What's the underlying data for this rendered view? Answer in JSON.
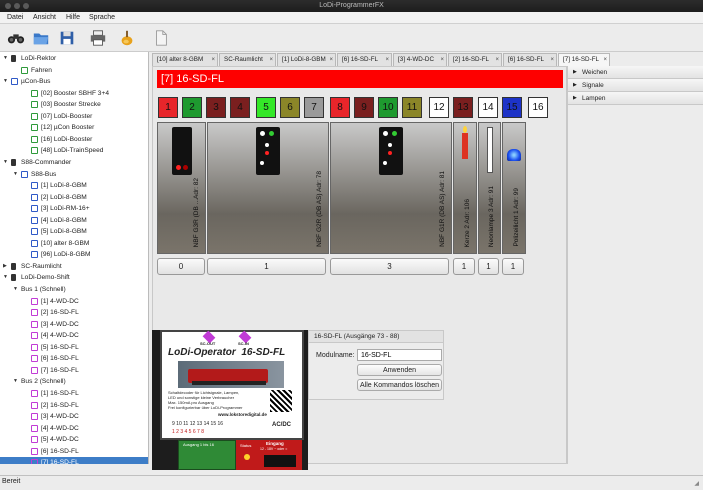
{
  "window": {
    "title": "LoDi-ProgrammerFX"
  },
  "menu": [
    "Datei",
    "Ansicht",
    "Hilfe",
    "Sprache"
  ],
  "toolbar": {
    "icons": [
      "binoculars-icon",
      "open-folder-icon",
      "save-icon",
      "print-icon",
      "clean-icon",
      "new-document-icon"
    ]
  },
  "tree": [
    {
      "label": "LoDi-Rektor",
      "depth": 0,
      "icon": "device",
      "expanded": true
    },
    {
      "label": "Fahren",
      "depth": 1,
      "icon": "green"
    },
    {
      "label": "µCon-Bus",
      "depth": 0,
      "icon": "bus",
      "expanded": true
    },
    {
      "label": "[02] Booster SBHF 3+4",
      "depth": 2,
      "icon": "green"
    },
    {
      "label": "[03] Booster Strecke",
      "depth": 2,
      "icon": "green"
    },
    {
      "label": "[07] LoDi-Booster",
      "depth": 2,
      "icon": "green"
    },
    {
      "label": "[12] µCon Booster",
      "depth": 2,
      "icon": "green"
    },
    {
      "label": "[16] LoDi-Booster",
      "depth": 2,
      "icon": "green"
    },
    {
      "label": "[48] LoDi-TrainSpeed",
      "depth": 2,
      "icon": "green"
    },
    {
      "label": "S88-Commander",
      "depth": 0,
      "icon": "device",
      "expanded": true
    },
    {
      "label": "S88-Bus",
      "depth": 1,
      "icon": "bus",
      "expanded": true
    },
    {
      "label": "[1] LoDi-8-GBM",
      "depth": 2,
      "icon": "blue"
    },
    {
      "label": "[2] LoDi-8-GBM",
      "depth": 2,
      "icon": "blue"
    },
    {
      "label": "[3] LoDi-RM-16+",
      "depth": 2,
      "icon": "blue"
    },
    {
      "label": "[4] LoDi-8-GBM",
      "depth": 2,
      "icon": "blue"
    },
    {
      "label": "[5] LoDi-8-GBM",
      "depth": 2,
      "icon": "blue"
    },
    {
      "label": "[10] alter 8-GBM",
      "depth": 2,
      "icon": "blue"
    },
    {
      "label": "[96] LoDi-8-GBM",
      "depth": 2,
      "icon": "blue"
    },
    {
      "label": "SC-Raumlicht",
      "depth": 0,
      "icon": "device",
      "expanded": false
    },
    {
      "label": "LoDi-Demo-Shift",
      "depth": 0,
      "icon": "device",
      "expanded": true
    },
    {
      "label": "Bus 1 (Schnell)",
      "depth": 1,
      "icon": "none",
      "expanded": true
    },
    {
      "label": "[1] 4-WD-DC",
      "depth": 2,
      "icon": "pink"
    },
    {
      "label": "[2] 16-SD-FL",
      "depth": 2,
      "icon": "pink"
    },
    {
      "label": "[3] 4-WD-DC",
      "depth": 2,
      "icon": "pink"
    },
    {
      "label": "[4] 4-WD-DC",
      "depth": 2,
      "icon": "pink"
    },
    {
      "label": "[5] 16-SD-FL",
      "depth": 2,
      "icon": "pink"
    },
    {
      "label": "[6] 16-SD-FL",
      "depth": 2,
      "icon": "pink"
    },
    {
      "label": "[7] 16-SD-FL",
      "depth": 2,
      "icon": "pink"
    },
    {
      "label": "Bus 2 (Schnell)",
      "depth": 1,
      "icon": "none",
      "expanded": true
    },
    {
      "label": "[1] 16-SD-FL",
      "depth": 2,
      "icon": "pink"
    },
    {
      "label": "[2] 16-SD-FL",
      "depth": 2,
      "icon": "pink"
    },
    {
      "label": "[3] 4-WD-DC",
      "depth": 2,
      "icon": "pink"
    },
    {
      "label": "[4] 4-WD-DC",
      "depth": 2,
      "icon": "pink"
    },
    {
      "label": "[5] 4-WD-DC",
      "depth": 2,
      "icon": "pink"
    },
    {
      "label": "[6] 16-SD-FL",
      "depth": 2,
      "icon": "pink"
    },
    {
      "label": "[7] 16-SD-FL",
      "depth": 2,
      "icon": "pink",
      "selected": true
    }
  ],
  "tabs": [
    {
      "label": "[10] alter 8-GBM",
      "closable": true
    },
    {
      "label": "SC-Raumlicht",
      "closable": true
    },
    {
      "label": "[1] LoDi-8-GBM",
      "closable": true
    },
    {
      "label": "[6] 16-SD-FL",
      "closable": true
    },
    {
      "label": "[3] 4-WD-DC",
      "closable": true
    },
    {
      "label": "[2] 16-SD-FL",
      "closable": true
    },
    {
      "label": "[6] 16-SD-FL",
      "closable": true
    },
    {
      "label": "[7] 16-SD-FL",
      "closable": true,
      "active": true
    }
  ],
  "module": {
    "title": "[7] 16-SD-FL",
    "outputs": [
      {
        "n": "1",
        "color": "#e8252a",
        "text": "#111"
      },
      {
        "n": "2",
        "color": "#1e9a2f",
        "text": "#111"
      },
      {
        "n": "3",
        "color": "#7a1f1f",
        "text": "#111"
      },
      {
        "n": "4",
        "color": "#7a1f1f",
        "text": "#111"
      },
      {
        "n": "5",
        "color": "#34e828",
        "text": "#111"
      },
      {
        "n": "6",
        "color": "#8b8628",
        "text": "#111"
      },
      {
        "n": "7",
        "color": "#9a9a9a",
        "text": "#111"
      },
      {
        "n": "8",
        "color": "#e8252a",
        "text": "#111"
      },
      {
        "n": "9",
        "color": "#7a1f1f",
        "text": "#111"
      },
      {
        "n": "10",
        "color": "#1e9a2f",
        "text": "#111"
      },
      {
        "n": "11",
        "color": "#8b8628",
        "text": "#111"
      },
      {
        "n": "12",
        "color": "#ffffff",
        "text": "#111"
      },
      {
        "n": "13",
        "color": "#7a1f1f",
        "text": "#111"
      },
      {
        "n": "14",
        "color": "#ffffff",
        "text": "#111"
      },
      {
        "n": "15",
        "color": "#1d33c8",
        "text": "#111"
      },
      {
        "n": "16",
        "color": "#ffffff",
        "text": "#111"
      }
    ],
    "signals": [
      {
        "label": "NBF G3R (DB ...Adr: 82",
        "button": "0",
        "type": "mast2"
      },
      {
        "label": "NBF G2R (DB AS) Adr: 78",
        "button": "1",
        "type": "mast5"
      },
      {
        "label": "NBF G1R (DB AS) Adr: 81",
        "button": "3",
        "type": "mast5b"
      },
      {
        "label": "Kerze 2 Adr: 106",
        "button": "1",
        "type": "candle"
      },
      {
        "label": "Neonlampe 3 Adr: 91",
        "button": "1",
        "type": "neon"
      },
      {
        "label": "Polizeilicht 1 Adr: 99",
        "button": "1",
        "type": "police"
      }
    ]
  },
  "right_panel": {
    "sections": [
      "Weichen",
      "Signale",
      "Lampen"
    ]
  },
  "product": {
    "header": "LoDi-Operator  16-SD-FL",
    "bus_labels": [
      "SC-OUT",
      "SC-IN"
    ],
    "bullets": [
      "Schaltdecoder für Lichtsignale, Lampen,",
      "LED und sonstige kleine Verbraucher",
      "Max. 150mA pro Ausgang",
      "Frei konfigurierbar über LoDi-Programmer"
    ],
    "url": "www.lokstoredigital.de",
    "pins_top": "9 10 11 12 13 14 15 16",
    "pins_bottom": "1 2 3 4 5 6 7 8",
    "acdc": "AC/DC",
    "ausgang_label": "Ausgang 1 bis 16",
    "eingang_label": "Eingang",
    "eingang_range": "12 - 18V ~ oder =",
    "status": "Status"
  },
  "form": {
    "header": "16-SD-FL (Ausgänge 73 - 88)",
    "name_label": "Modulname:",
    "name_value": "16-SD-FL",
    "apply": "Anwenden",
    "delete_all": "Alle Kommandos löschen"
  },
  "statusbar": {
    "text": "Bereit"
  }
}
